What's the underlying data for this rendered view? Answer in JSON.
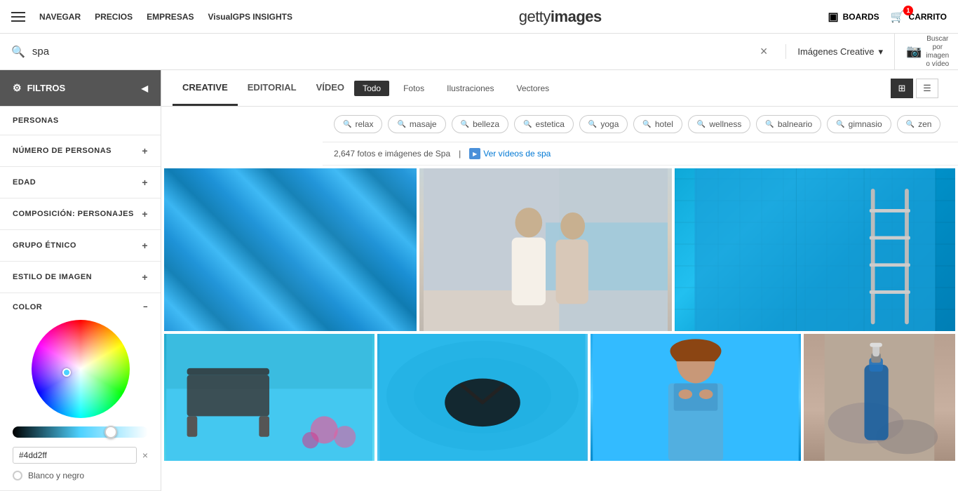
{
  "topNav": {
    "hamburger_label": "menu",
    "links": [
      "NAVEGAR",
      "PRECIOS",
      "EMPRESAS",
      "VisualGPS INSIGHTS"
    ],
    "logo_text": "gettyimages",
    "logo_text_bold": "images",
    "boards_label": "BOARDS",
    "cart_label": "CARRITO",
    "cart_count": "1"
  },
  "searchBar": {
    "query": "spa",
    "clear_label": "×",
    "type_label": "Imágenes Creative",
    "visual_search_label": "Buscar por imagen o vídeo",
    "chevron": "▾"
  },
  "filterTabsRow": {
    "filter_label": "FILTROS",
    "tabs": [
      "CREATIVE",
      "EDITORIAL",
      "VÍDEO"
    ],
    "active_tab": "CREATIVE",
    "type_buttons": [
      "Todo",
      "Fotos",
      "Ilustraciones",
      "Vectores"
    ],
    "active_type": "Todo"
  },
  "tags": [
    "relax",
    "masaje",
    "belleza",
    "estetica",
    "yoga",
    "hotel",
    "wellness",
    "balneario",
    "gimnasio",
    "zen"
  ],
  "results": {
    "count_text": "2,647 fotos e imágenes de Spa",
    "video_link": "Ver vídeos de spa"
  },
  "sidebar": {
    "sections": [
      {
        "id": "personas",
        "label": "PERSONAS",
        "expandable": false
      },
      {
        "id": "numero-personas",
        "label": "NÚMERO DE PERSONAS",
        "expandable": true
      },
      {
        "id": "edad",
        "label": "EDAD",
        "expandable": true
      },
      {
        "id": "composicion",
        "label": "COMPOSICIÓN: PERSONAJES",
        "expandable": true
      },
      {
        "id": "grupo-etnico",
        "label": "GRUPO ÉTNICO",
        "expandable": true
      },
      {
        "id": "estilo-imagen",
        "label": "ESTILO DE IMAGEN",
        "expandable": true
      }
    ],
    "color": {
      "label": "COLOR",
      "hex_value": "#4dd2ff",
      "hex_input": "#4dd2ff",
      "bw_label": "Blanco y negro"
    }
  },
  "images": {
    "row1": [
      {
        "id": "img-1",
        "type": "water",
        "alt": "Blue water texture"
      },
      {
        "id": "img-2",
        "type": "spa-women",
        "alt": "Spa women in robes"
      },
      {
        "id": "img-3",
        "type": "pool-ladder",
        "alt": "Pool ladder"
      }
    ],
    "row2": [
      {
        "id": "img-4",
        "type": "pool-chair",
        "alt": "Pool chair"
      },
      {
        "id": "img-5",
        "type": "flip-flop",
        "alt": "Flip flop on water"
      },
      {
        "id": "img-6",
        "type": "woman-blue",
        "alt": "Woman in blue"
      },
      {
        "id": "img-7",
        "type": "blue-bottle",
        "alt": "Blue bottle"
      }
    ]
  }
}
